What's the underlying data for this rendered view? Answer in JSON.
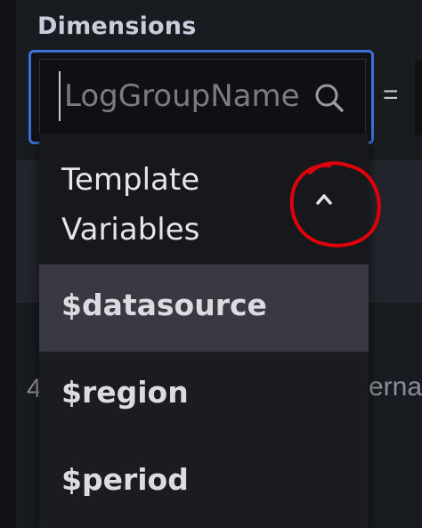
{
  "section": {
    "label": "Dimensions"
  },
  "dimension_input": {
    "placeholder": "LogGroupName",
    "operator": "="
  },
  "dropdown": {
    "group_title": "Template Variables",
    "items": [
      {
        "label": "$datasource",
        "active": true
      },
      {
        "label": "$region",
        "active": false
      },
      {
        "label": "$period",
        "active": false
      }
    ]
  },
  "background_text": {
    "left": "4",
    "right": "erna"
  },
  "colors": {
    "focus_border": "#3d71d9",
    "annotation": "#e0000b",
    "active_item": "#383942"
  }
}
